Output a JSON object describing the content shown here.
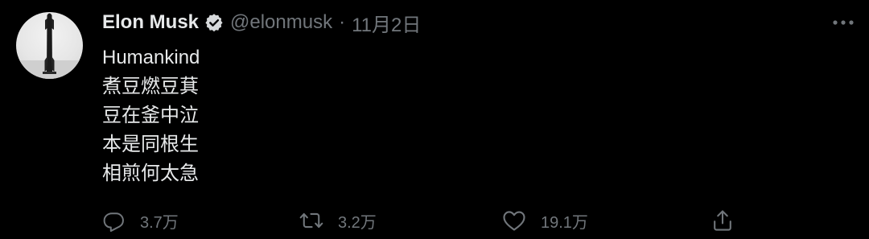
{
  "tweet": {
    "author": {
      "name": "Elon Musk",
      "handle": "@elonmusk",
      "verified": true,
      "avatar_icon": "starship-avatar-icon"
    },
    "separator": "·",
    "date": "11月2日",
    "text_lines": [
      "Humankind",
      "煮豆燃豆萁",
      "豆在釜中泣",
      "本是同根生",
      "相煎何太急"
    ],
    "actions": {
      "reply": {
        "icon": "reply-icon",
        "count": "3.7万"
      },
      "retweet": {
        "icon": "retweet-icon",
        "count": "3.2万"
      },
      "like": {
        "icon": "heart-icon",
        "count": "19.1万"
      },
      "share": {
        "icon": "share-icon"
      }
    }
  },
  "colors": {
    "background": "#000000",
    "primary_text": "#e7e9ea",
    "secondary_text": "#71767b"
  }
}
